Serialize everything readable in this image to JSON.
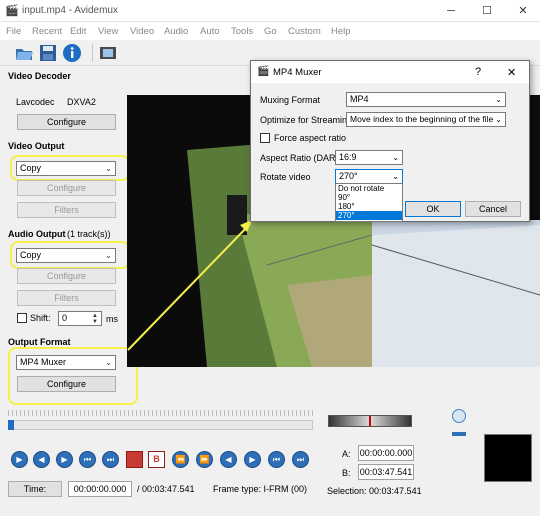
{
  "window": {
    "title": "input.mp4 - Avidemux",
    "minimize": "─",
    "maximize": "☐",
    "close": "✕"
  },
  "menu": [
    "File",
    "Recent",
    "Edit",
    "View",
    "Video",
    "Audio",
    "Auto",
    "Tools",
    "Go",
    "Custom",
    "Help"
  ],
  "left": {
    "video_decoder": {
      "heading": "Video Decoder",
      "codec": "Lavcodec",
      "decoder": "DXVA2",
      "configure": "Configure"
    },
    "video_output": {
      "heading": "Video Output",
      "selected": "Copy",
      "configure": "Configure",
      "filters": "Filters"
    },
    "audio_output": {
      "heading": "Audio Output",
      "tracks": "(1 track(s))",
      "selected": "Copy",
      "configure": "Configure",
      "filters": "Filters",
      "shift_label": "Shift:",
      "shift_value": "0",
      "shift_unit": "ms"
    },
    "output_format": {
      "heading": "Output Format",
      "selected": "MP4 Muxer",
      "configure": "Configure"
    }
  },
  "dialog": {
    "title": "MP4 Muxer",
    "help": "?",
    "close": "✕",
    "muxing_format_label": "Muxing Format",
    "muxing_format_value": "MP4",
    "streaming_label": "Optimize for Streaming",
    "streaming_value": "Move index to the beginning of the file",
    "force_aspect_label": "Force aspect ratio",
    "aspect_label": "Aspect Ratio (DAR)",
    "aspect_value": "16:9",
    "rotate_label": "Rotate video",
    "rotate_value": "270°",
    "rotate_options": [
      "Do not rotate",
      "90°",
      "180°",
      "270°"
    ],
    "ok": "OK",
    "cancel": "Cancel"
  },
  "bottom": {
    "time_button": "Time:",
    "current_time": "00:00:00.000",
    "total_time": "/ 00:03:47.541",
    "frame_type": "Frame type:  I-FRM (00)",
    "a_label": "A:",
    "a_value": "00:00:00.000",
    "b_label": "B:",
    "b_value": "00:03:47.541",
    "selection": "Selection: 00:03:47.541"
  },
  "colors": {
    "highlight": "#f3f04a",
    "accent": "#0078d7",
    "nav": "#2d6fb8"
  }
}
